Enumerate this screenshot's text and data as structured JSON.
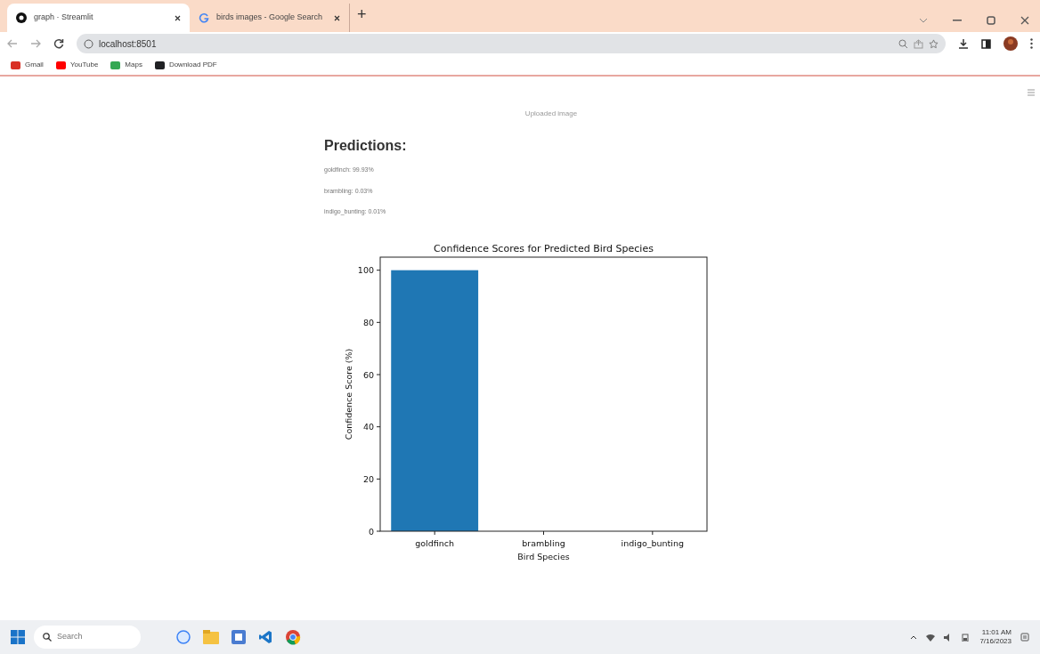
{
  "tabs": [
    {
      "label": "graph · Streamlit",
      "kind": "site",
      "selected": true
    },
    {
      "label": "birds images - Google Search",
      "kind": "search",
      "selected": false
    }
  ],
  "new_tab": "+",
  "address_bar": {
    "url": "localhost:8501"
  },
  "bookmarks": [
    {
      "label": "Gmail",
      "color": "#d93025"
    },
    {
      "label": "YouTube",
      "color": "#ff0000"
    },
    {
      "label": "Maps",
      "color": "#34a853"
    },
    {
      "label": "Download PDF",
      "color": "#202124"
    }
  ],
  "page": {
    "image_caption": "Uploaded image",
    "heading": "Predictions:",
    "predictions": [
      "goldfinch: 99.93%",
      "brambling: 0.03%",
      "indigo_bunting: 0.01%"
    ],
    "chart_data": {
      "type": "bar",
      "title": "Confidence Scores for Predicted Bird Species",
      "xlabel": "Bird Species",
      "ylabel": "Confidence Score (%)",
      "categories": [
        "goldfinch",
        "brambling",
        "indigo_bunting"
      ],
      "series": [
        {
          "color": "#1f77b4",
          "values": [
            100,
            0,
            0
          ]
        }
      ],
      "ylim": [
        0,
        105
      ],
      "yticks": [
        0,
        20,
        40,
        60,
        80,
        100
      ]
    }
  },
  "taskbar": {
    "search_placeholder": "Search",
    "time": "11:01 AM",
    "date": "7/16/2023"
  }
}
